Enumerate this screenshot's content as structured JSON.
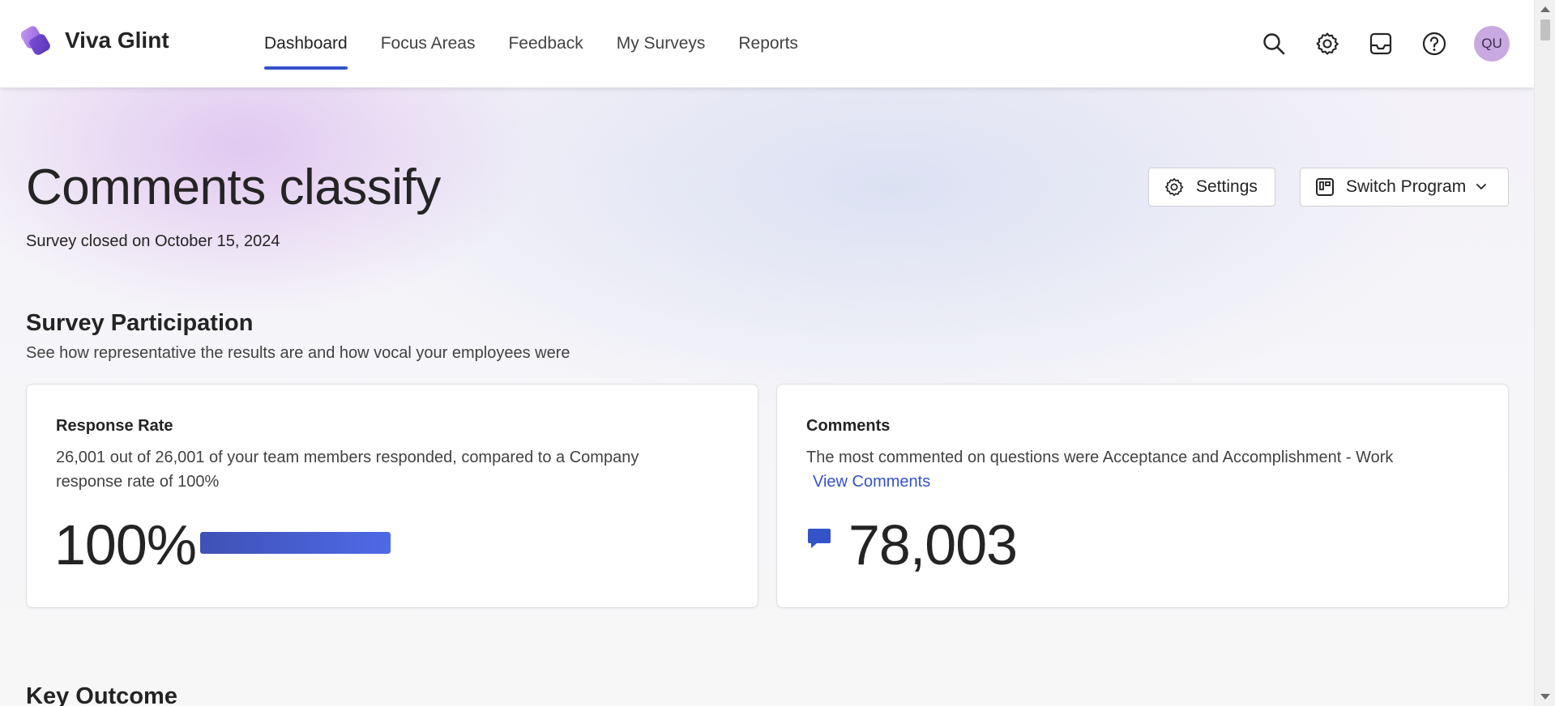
{
  "app": {
    "name": "Viva Glint",
    "accent_color": "#3553c8",
    "logo_color": "#8f5be0"
  },
  "nav": {
    "items": [
      {
        "label": "Dashboard",
        "active": true
      },
      {
        "label": "Focus Areas",
        "active": false
      },
      {
        "label": "Feedback",
        "active": false
      },
      {
        "label": "My Surveys",
        "active": false
      },
      {
        "label": "Reports",
        "active": false
      }
    ]
  },
  "top_icons": [
    "search-icon",
    "gear-icon",
    "inbox-icon",
    "help-icon"
  ],
  "user": {
    "initials": "QU"
  },
  "header": {
    "title": "Comments classify",
    "subtitle": "Survey closed on October 15, 2024",
    "settings_label": "Settings",
    "switch_program_label": "Switch Program"
  },
  "participation": {
    "title": "Survey Participation",
    "subtitle": "See how representative the results are and how vocal your employees were",
    "response_rate": {
      "title": "Response Rate",
      "description": "26,001 out of 26,001 of your team members responded, compared to a Company response rate of 100%",
      "value": "100%",
      "progress_fraction": 1.0
    },
    "comments": {
      "title": "Comments",
      "description": "The most commented on questions were Acceptance and Accomplishment - Work",
      "link_label": "View Comments",
      "count": "78,003"
    }
  },
  "key_outcome": {
    "title": "Key Outcome"
  }
}
